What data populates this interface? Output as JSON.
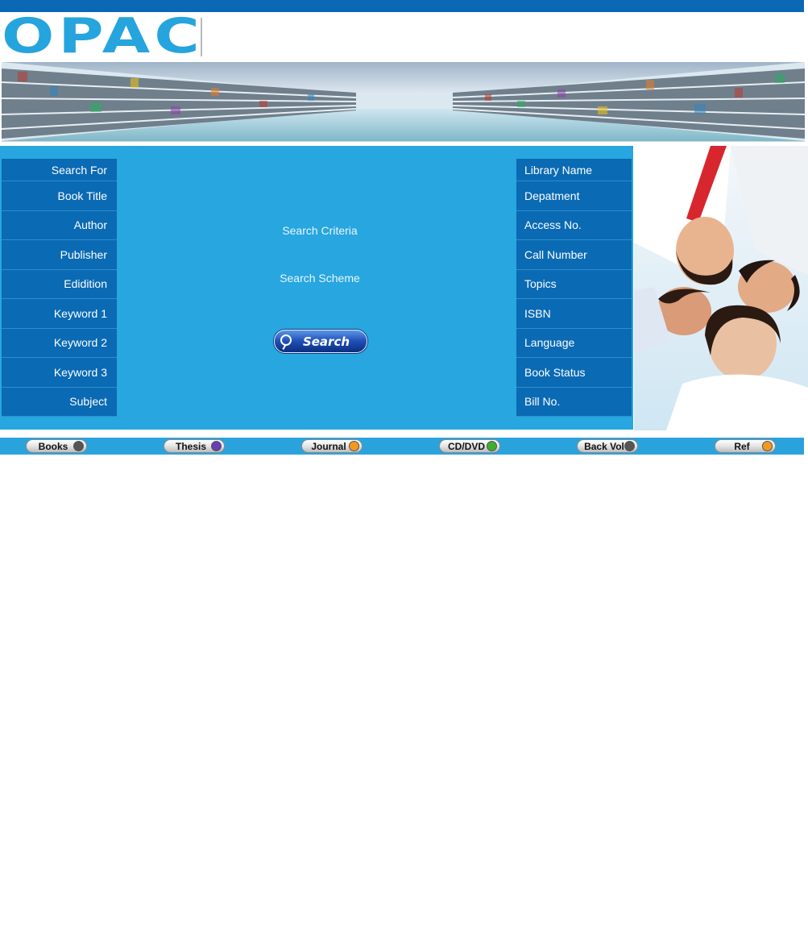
{
  "logo": {
    "text": "OPAC"
  },
  "left_fields": [
    {
      "label": "Search For"
    },
    {
      "label": "Book Title"
    },
    {
      "label": "Author"
    },
    {
      "label": "Publisher"
    },
    {
      "label": "Edidition"
    },
    {
      "label": "Keyword 1"
    },
    {
      "label": "Keyword 2"
    },
    {
      "label": "Keyword 3"
    },
    {
      "label": "Subject"
    }
  ],
  "right_fields": [
    {
      "label": "Library Name"
    },
    {
      "label": "Depatment"
    },
    {
      "label": "Access No."
    },
    {
      "label": "Call Number"
    },
    {
      "label": "Topics"
    },
    {
      "label": "ISBN"
    },
    {
      "label": "Language"
    },
    {
      "label": "Book Status"
    },
    {
      "label": "Bill No."
    }
  ],
  "center": {
    "criteria_label": "Search Criteria",
    "scheme_label": "Search Scheme",
    "search_button": "Search"
  },
  "bottom_nav": [
    {
      "label": "Books",
      "color": "#555555"
    },
    {
      "label": "Thesis",
      "color": "#6a3fb0"
    },
    {
      "label": "Journal",
      "color": "#f39a1e"
    },
    {
      "label": "CD/DVD",
      "color": "#3fae2c"
    },
    {
      "label": "Back Vol",
      "color": "#555555"
    },
    {
      "label": "Ref",
      "color": "#f39a1e"
    }
  ],
  "colors": {
    "top_bar": "#0a68b5",
    "logo": "#26a4dd",
    "panel": "#27a6df",
    "field_cell": "#0a6ab4",
    "bottom_bar": "#2aa3dd"
  }
}
